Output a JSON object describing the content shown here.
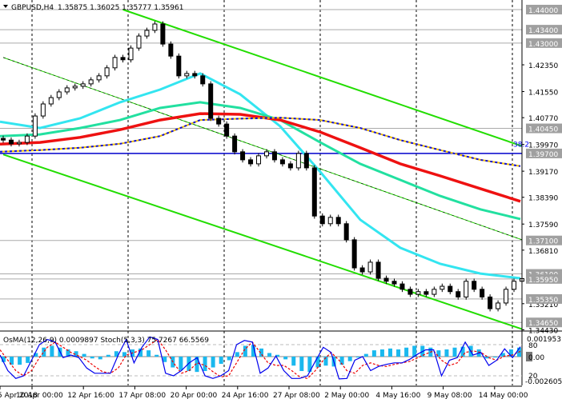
{
  "header": {
    "symbol": "GBPUSD,H4",
    "ohlc": "1.35875 1.36025 1.35777 1.35961",
    "menu_icon": "triangle-down-icon"
  },
  "colors": {
    "bull_candle": "#ffffff",
    "bear_candle": "#000000",
    "channel": "#22dd00",
    "ema_fast": "#33e5f0",
    "ema_mid": "#22e0a0",
    "ema_slow": "#ee1111",
    "ema_long_a": "#1010dd",
    "ema_long_b": "#f0c000",
    "level_line": "#aaaaaa",
    "support_blue": "#0000cc",
    "osma_bar": "#1ab8ee",
    "stoch_main": "#0000ee",
    "stoch_signal": "#ee0000"
  },
  "chart_data": [
    {
      "type": "candlestick",
      "title": "GBPUSD,H4",
      "ylim": [
        1.3425,
        1.4429
      ],
      "grid": false,
      "closes": [
        1.401,
        1.3999,
        1.4003,
        1.4022,
        1.4082,
        1.4118,
        1.4137,
        1.4154,
        1.4166,
        1.4171,
        1.4178,
        1.419,
        1.4202,
        1.4226,
        1.4257,
        1.425,
        1.4285,
        1.4321,
        1.4338,
        1.4357,
        1.4297,
        1.4261,
        1.4202,
        1.4209,
        1.4202,
        1.4178,
        1.4075,
        1.4058,
        1.4022,
        1.3975,
        1.3951,
        1.3939,
        1.3963,
        1.3975,
        1.3951,
        1.3939,
        1.3927,
        1.397,
        1.3927,
        1.3783,
        1.376,
        1.3779,
        1.376,
        1.3712,
        1.3628,
        1.3616,
        1.3645,
        1.3597,
        1.3588,
        1.358,
        1.3564,
        1.3549,
        1.3557,
        1.3549,
        1.3564,
        1.3573,
        1.3557,
        1.3541,
        1.3588,
        1.3564,
        1.3541,
        1.3506,
        1.3523,
        1.3564,
        1.3588,
        1.3596
      ],
      "moving_averages": [
        {
          "color_key": "ema_fast",
          "values": [
            1.4065,
            1.4046,
            1.4075,
            1.4123,
            1.4161,
            1.4209,
            1.4147,
            1.4051,
            1.3915,
            1.3772,
            1.3688,
            1.364,
            1.3611,
            1.3597
          ]
        },
        {
          "color_key": "ema_mid",
          "values": [
            1.4022,
            1.4027,
            1.4046,
            1.407,
            1.4106,
            1.4123,
            1.4106,
            1.407,
            1.4003,
            1.3939,
            1.3891,
            1.3843,
            1.3803,
            1.3774
          ]
        },
        {
          "color_key": "ema_slow",
          "values": [
            1.3998,
            1.4003,
            1.4018,
            1.4041,
            1.407,
            1.4089,
            1.4087,
            1.407,
            1.4034,
            1.3987,
            1.3939,
            1.3903,
            1.3865,
            1.3827
          ]
        },
        {
          "color_key": "ema_long_a",
          "values": [
            1.3975,
            1.398,
            1.3987,
            1.3999,
            1.4022,
            1.407,
            1.4074,
            1.4077,
            1.407,
            1.4046,
            1.401,
            1.398,
            1.3951,
            1.3932
          ]
        }
      ],
      "channel_lines": [
        {
          "from": 1.44,
          "to": 1.3992,
          "start_index": 15
        },
        {
          "from": 1.4257,
          "to": 1.3712,
          "start_index": 0
        },
        {
          "from": 1.3967,
          "to": 1.3445,
          "start_index": 0
        }
      ],
      "levels": [
        "1.44000",
        "1.43400",
        "1.43000",
        "1.40450",
        "1.39700",
        "1.37100",
        "1.36100",
        "1.35950",
        "1.35350",
        "1.34650"
      ],
      "fib_label": "38.2",
      "y_tick_labels": [
        "1.42350",
        "1.41550",
        "1.40770",
        "1.39970",
        "1.39170",
        "1.38390",
        "1.37590",
        "1.36810",
        "1.35210",
        "1.34430"
      ],
      "x_tick_labels": [
        "5 Apr 2018",
        "10 Apr 00:00",
        "12 Apr 16:00",
        "17 Apr 08:00",
        "20 Apr 00:00",
        "24 Apr 16:00",
        "27 Apr 08:00",
        "2 May 00:00",
        "4 May 16:00",
        "9 May 08:00",
        "14 May 00:00"
      ]
    },
    {
      "type": "bar+line",
      "title": "OsMA(12,26,9) 0.0009897  Stoch(5,3,3) 75.7267 66.5569",
      "osma_ylim": [
        -0.002605,
        0.001953
      ],
      "stoch_levels": [
        "80",
        "20"
      ],
      "y_tick_labels": [
        "0.001953",
        "0.00",
        "-0.002605"
      ],
      "osma": [
        -0.0006,
        -0.0009,
        -0.0009,
        -0.0007,
        0.0004,
        0.001,
        0.0012,
        0.001,
        0.0008,
        0.0006,
        0.0003,
        -0.0002,
        -0.0003,
        0.0002,
        0.0006,
        0.0005,
        0.0008,
        0.0009,
        0.0007,
        0.0002,
        -0.0006,
        -0.0012,
        -0.0015,
        -0.0016,
        -0.0017,
        -0.0016,
        -0.0012,
        -0.0008,
        -0.0004,
        0.0005,
        0.0012,
        0.0013,
        0.0009,
        0.0004,
        0.0002,
        -0.0003,
        -0.001,
        -0.0016,
        -0.0017,
        -0.0012,
        -0.001,
        -0.0011,
        -0.0009,
        -0.0005,
        -0.0001,
        0.0003,
        0.0007,
        0.0008,
        0.0009,
        0.0008,
        0.001,
        0.0012,
        0.0012,
        0.001,
        0.0007,
        0.0008,
        0.001,
        0.0011,
        0.0012,
        0.0008,
        -0.0002,
        -0.0001,
        0.0004,
        0.0008,
        0.001
      ],
      "stoch_main": [
        60,
        30,
        15,
        20,
        50,
        80,
        90,
        85,
        55,
        60,
        55,
        35,
        25,
        25,
        25,
        60,
        90,
        45,
        75,
        95,
        90,
        25,
        20,
        30,
        45,
        55,
        20,
        15,
        20,
        30,
        80,
        88,
        85,
        25,
        35,
        58,
        30,
        15,
        15,
        20,
        48,
        75,
        65,
        14,
        15,
        50,
        57,
        30,
        38,
        42,
        45,
        45,
        52,
        62,
        70,
        70,
        20,
        50,
        55,
        85,
        60,
        65,
        40,
        50,
        72,
        55,
        76
      ],
      "stoch_signal": [
        70,
        50,
        30,
        20,
        30,
        55,
        75,
        85,
        75,
        65,
        58,
        50,
        38,
        28,
        25,
        35,
        60,
        65,
        70,
        80,
        90,
        70,
        45,
        25,
        30,
        45,
        40,
        28,
        18,
        20,
        45,
        70,
        85,
        65,
        45,
        40,
        40,
        30,
        18,
        15,
        30,
        50,
        65,
        50,
        30,
        25,
        40,
        45,
        40,
        38,
        42,
        45,
        48,
        55,
        62,
        68,
        50,
        40,
        45,
        65,
        68,
        65,
        55,
        50,
        58,
        60,
        67
      ]
    }
  ]
}
